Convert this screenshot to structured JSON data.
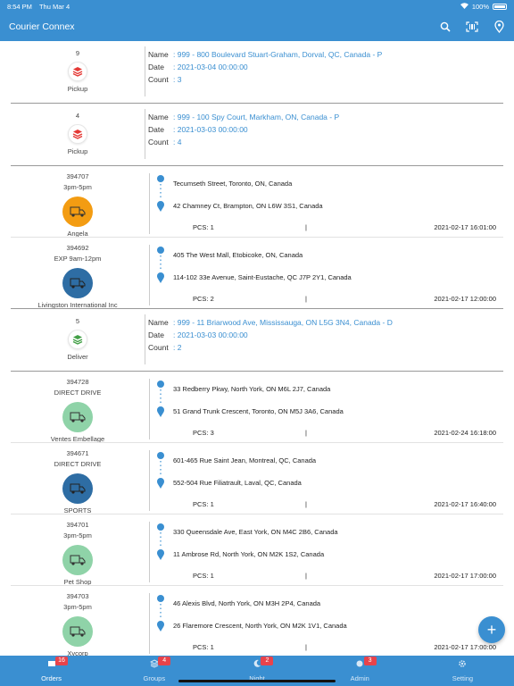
{
  "status": {
    "time": "8:54 PM",
    "date": "Thu Mar 4",
    "battery": "100%"
  },
  "app": {
    "title": "Courier Connex",
    "actions": [
      "search-icon",
      "barcode-scan-icon",
      "map-pin-icon"
    ]
  },
  "groups": [
    {
      "count": "9",
      "type": "Pickup",
      "name": ": 999 - 800 Boulevard Stuart-Graham, Dorval, QC, Canada - P",
      "date": ": 2021-03-04 00:00:00",
      "cnt": ": 3",
      "color": "#e53935"
    },
    {
      "count": "4",
      "type": "Pickup",
      "name": ": 999 - 100 Spy Court, Markham, ON, Canada - P",
      "date": ": 2021-03-03 00:00:00",
      "cnt": ": 4",
      "color": "#e53935"
    },
    {
      "count": "5",
      "type": "Deliver",
      "name": ": 999 - 11 Briarwood Ave, Mississauga, ON L5G 3N4, Canada - D",
      "date": ": 2021-03-03 00:00:00",
      "cnt": ": 2",
      "color": "#43a047"
    }
  ],
  "labels": {
    "name": "Name",
    "date": "Date",
    "count": "Count",
    "sep": "|"
  },
  "orders": [
    {
      "id": "394707",
      "window": "3pm-5pm",
      "customer": "Angela",
      "from": "Tecumseth Street, Toronto, ON, Canada",
      "to": "42 Chamney Ct, Brampton, ON L6W 3S1, Canada",
      "pcs": "PCS: 1",
      "datetime": "2021-02-17 16:01:00",
      "color": "#f39c12"
    },
    {
      "id": "394692",
      "window": "EXP 9am-12pm",
      "customer": "Livingston International Inc",
      "from": "405 The West Mall, Etobicoke, ON, Canada",
      "to": "114-102 33e Avenue, Saint-Eustache, QC J7P 2Y1, Canada",
      "pcs": "PCS: 2",
      "datetime": "2021-02-17 12:00:00",
      "color": "#2e6da4"
    },
    {
      "id": "394728",
      "window": "DIRECT DRIVE",
      "customer": "Ventes Embellage",
      "from": "33 Redberry Pkwy, North York, ON M6L 2J7, Canada",
      "to": "51 Grand Trunk Crescent, Toronto, ON M5J 3A6, Canada",
      "pcs": "PCS: 3",
      "datetime": "2021-02-24 16:18:00",
      "color": "#8fd3a8"
    },
    {
      "id": "394671",
      "window": "DIRECT DRIVE",
      "customer": "SPORTS",
      "from": "601-465 Rue Saint Jean, Montreal, QC, Canada",
      "to": "552-504 Rue Filiatrault, Laval, QC, Canada",
      "pcs": "PCS: 1",
      "datetime": "2021-02-17 16:40:00",
      "color": "#2e6da4"
    },
    {
      "id": "394701",
      "window": "3pm-5pm",
      "customer": "Pet Shop",
      "from": "330 Queensdale Ave, East York, ON M4C 2B6, Canada",
      "to": "11 Ambrose Rd, North York, ON M2K 1S2, Canada",
      "pcs": "PCS: 1",
      "datetime": "2021-02-17 17:00:00",
      "color": "#8fd3a8"
    },
    {
      "id": "394703",
      "window": "3pm-5pm",
      "customer": "Xycorp",
      "from": "46 Alexis Blvd, North York, ON M3H 2P4, Canada",
      "to": "26 Flaremore Crescent, North York, ON M2K 1V1, Canada",
      "pcs": "PCS: 1",
      "datetime": "2021-02-17 17:00:00",
      "color": "#8fd3a8"
    }
  ],
  "tabs": [
    {
      "label": "Orders",
      "badge": "16",
      "active": true
    },
    {
      "label": "Groups",
      "badge": "4"
    },
    {
      "label": "Night",
      "badge": "2"
    },
    {
      "label": "Admin",
      "badge": "3"
    },
    {
      "label": "Setting",
      "badge": ""
    }
  ],
  "fab": {
    "label": "+"
  }
}
